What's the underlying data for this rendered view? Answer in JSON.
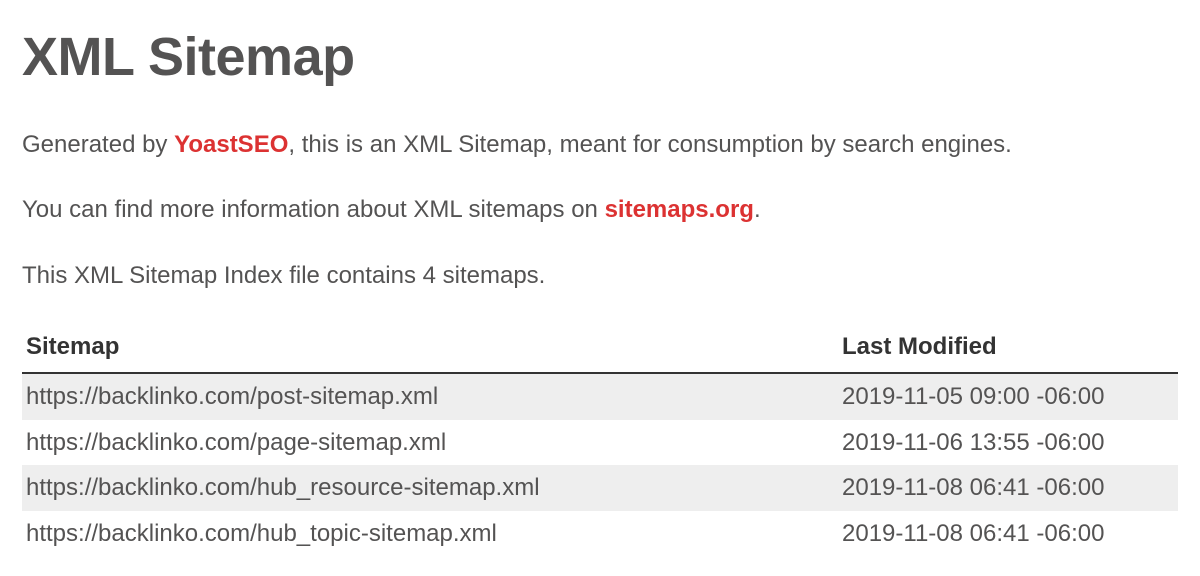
{
  "header": {
    "title": "XML Sitemap"
  },
  "intro": {
    "line1_prefix": "Generated by ",
    "line1_link": "YoastSEO",
    "line1_suffix": ", this is an XML Sitemap, meant for consumption by search engines.",
    "line2_prefix": "You can find more information about XML sitemaps on ",
    "line2_link": "sitemaps.org",
    "line2_suffix": ".",
    "line3": "This XML Sitemap Index file contains 4 sitemaps."
  },
  "table": {
    "headers": {
      "sitemap": "Sitemap",
      "modified": "Last Modified"
    },
    "rows": [
      {
        "url": "https://backlinko.com/post-sitemap.xml",
        "modified": "2019-11-05 09:00 -06:00"
      },
      {
        "url": "https://backlinko.com/page-sitemap.xml",
        "modified": "2019-11-06 13:55 -06:00"
      },
      {
        "url": "https://backlinko.com/hub_resource-sitemap.xml",
        "modified": "2019-11-08 06:41 -06:00"
      },
      {
        "url": "https://backlinko.com/hub_topic-sitemap.xml",
        "modified": "2019-11-08 06:41 -06:00"
      }
    ]
  }
}
